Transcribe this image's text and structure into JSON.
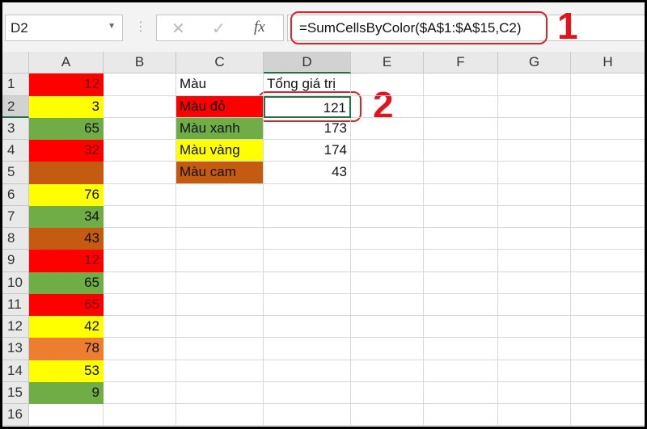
{
  "name_box": "D2",
  "formula": "=SumCellsByColor($A$1:$A$15,C2)",
  "icons": {
    "cancel": "✕",
    "confirm": "✓",
    "fx": "fx"
  },
  "annotations": [
    "1",
    "2"
  ],
  "columns": [
    "A",
    "B",
    "C",
    "D",
    "E",
    "F",
    "G",
    "H"
  ],
  "colors": {
    "red": "#ff0000",
    "yellow": "#ffff00",
    "green": "#70ad47",
    "brown": "#c55a11",
    "orange": "#ed7d31"
  },
  "rows": [
    {
      "n": "1",
      "a": "12",
      "a_color": "#ff0000",
      "c": "Màu",
      "c_color": "",
      "d": "Tổng giá trị"
    },
    {
      "n": "2",
      "a": "3",
      "a_color": "#ffff00",
      "c": "Màu đỏ",
      "c_color": "#ff0000",
      "d": "121"
    },
    {
      "n": "3",
      "a": "65",
      "a_color": "#70ad47",
      "c": "Màu xanh",
      "c_color": "#70ad47",
      "d": "173"
    },
    {
      "n": "4",
      "a": "32",
      "a_color": "#ff0000",
      "c": "Màu vàng",
      "c_color": "#ffff00",
      "d": "174"
    },
    {
      "n": "5",
      "a": "",
      "a_color": "#c55a11",
      "c": "Màu cam",
      "c_color": "#c55a11",
      "d": "43"
    },
    {
      "n": "6",
      "a": "76",
      "a_color": "#ffff00",
      "c": "",
      "c_color": "",
      "d": ""
    },
    {
      "n": "7",
      "a": "34",
      "a_color": "#70ad47",
      "c": "",
      "c_color": "",
      "d": ""
    },
    {
      "n": "8",
      "a": "43",
      "a_color": "#c55a11",
      "c": "",
      "c_color": "",
      "d": ""
    },
    {
      "n": "9",
      "a": "12",
      "a_color": "#ff0000",
      "c": "",
      "c_color": "",
      "d": ""
    },
    {
      "n": "10",
      "a": "65",
      "a_color": "#70ad47",
      "c": "",
      "c_color": "",
      "d": ""
    },
    {
      "n": "11",
      "a": "65",
      "a_color": "#ff0000",
      "c": "",
      "c_color": "",
      "d": ""
    },
    {
      "n": "12",
      "a": "42",
      "a_color": "#ffff00",
      "c": "",
      "c_color": "",
      "d": ""
    },
    {
      "n": "13",
      "a": "78",
      "a_color": "#ed7d31",
      "c": "",
      "c_color": "",
      "d": ""
    },
    {
      "n": "14",
      "a": "53",
      "a_color": "#ffff00",
      "c": "",
      "c_color": "",
      "d": ""
    },
    {
      "n": "15",
      "a": "9",
      "a_color": "#70ad47",
      "c": "",
      "c_color": "",
      "d": ""
    },
    {
      "n": "16",
      "a": "",
      "a_color": "",
      "c": "",
      "c_color": "",
      "d": ""
    }
  ]
}
